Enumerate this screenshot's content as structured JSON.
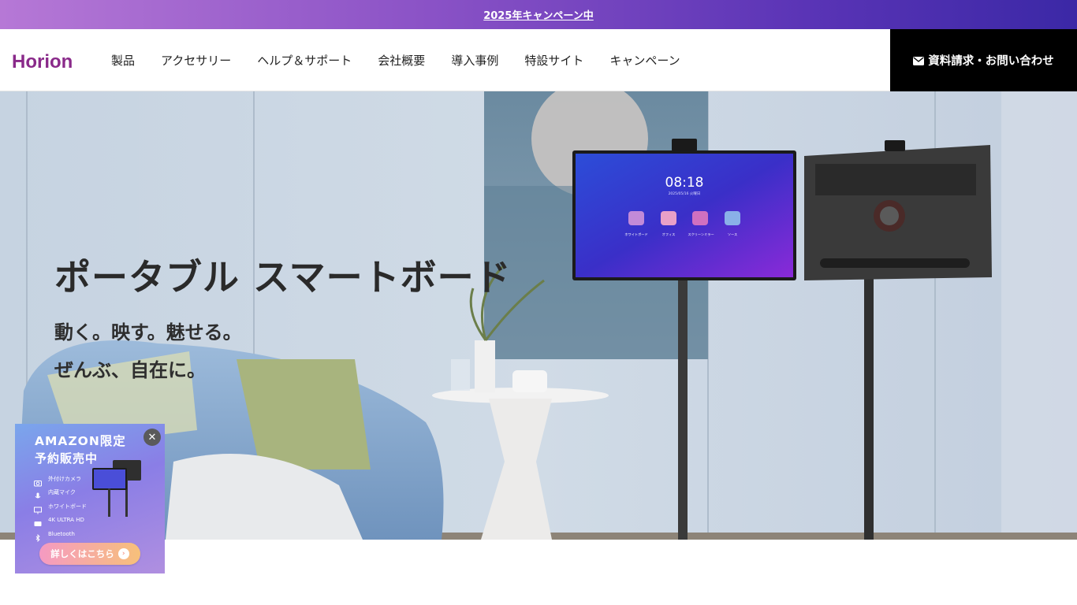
{
  "banner": {
    "text": "2025年キャンペーン中"
  },
  "header": {
    "logo_text": "Horion",
    "nav": [
      "製品",
      "アクセサリー",
      "ヘルプ＆サポート",
      "会社概要",
      "導入事例",
      "特設サイト",
      "キャンペーン"
    ],
    "cta_label": "資料請求・お問い合わせ"
  },
  "hero": {
    "title": "ポータブル スマートボード",
    "subtitle_line1": "動く。映す。魅せる。",
    "subtitle_line2": "ぜんぶ、自在に。",
    "screen_time": "08:18",
    "screen_date": "2025/05/16 火曜日",
    "screen_apps": [
      "ホワイトボード",
      "オフィス",
      "スクリーンミラー",
      "ソース"
    ]
  },
  "promo": {
    "title": "AMAZON限定",
    "subtitle": "予約販売中",
    "close_symbol": "✕",
    "features": [
      "外付けカメラ",
      "内蔵マイク",
      "ホワイトボード",
      "4K ULTRA HD",
      "Bluetooth"
    ],
    "button_label": "詳しくはこちら",
    "button_arrow": "›"
  },
  "colors": {
    "brand_purple": "#8a2a8a",
    "banner_gradient_start": "#b678d6",
    "banner_gradient_end": "#3b28a6",
    "cta_background": "#000000"
  }
}
